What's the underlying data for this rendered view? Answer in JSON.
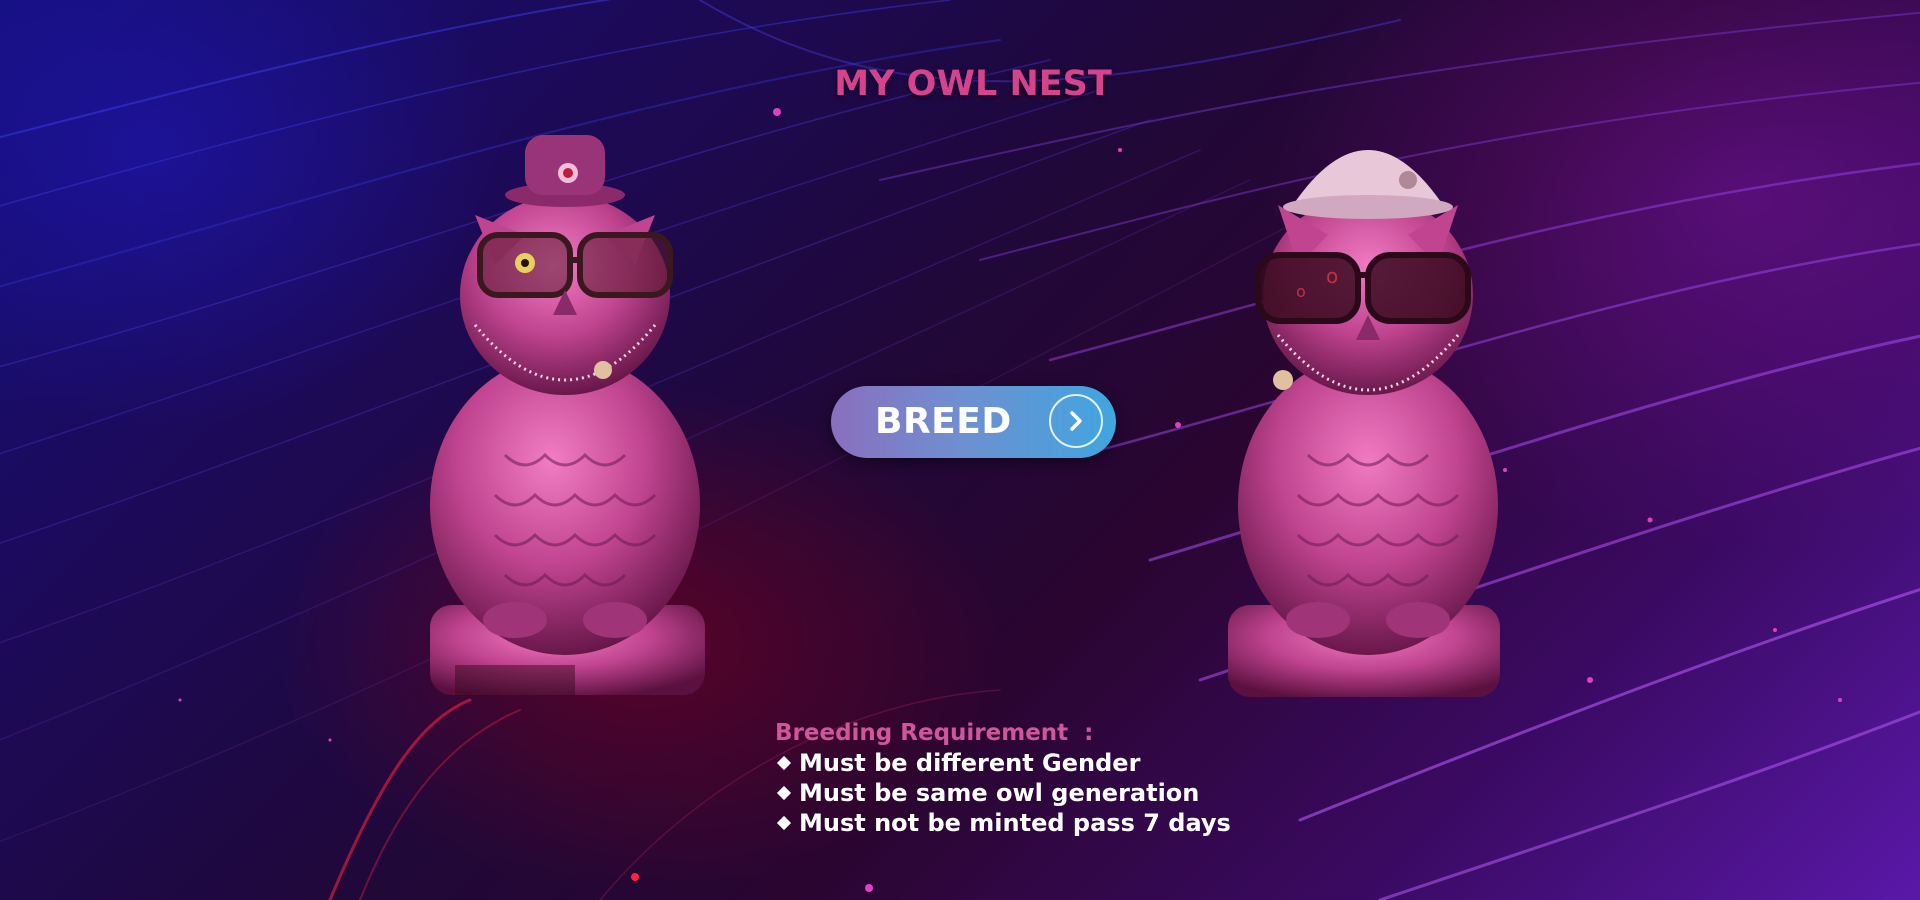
{
  "page": {
    "title": "MY OWL NEST"
  },
  "breed": {
    "button_label": "BREED",
    "icon": "chevron-right-icon"
  },
  "owls": {
    "left": {
      "image": "owl-statue-hat-glasses"
    },
    "right": {
      "image": "owl-statue-helmet-sunglasses"
    }
  },
  "requirements": {
    "heading": "Breeding Requirement  :",
    "items": [
      {
        "text": "Must be different Gender"
      },
      {
        "text": "Must be same owl generation"
      },
      {
        "text": "Must not be minted pass 7 days"
      }
    ]
  },
  "colors": {
    "title": "#d4438c",
    "heading": "#d0559a",
    "owl_pink": "#c0448f",
    "button_start": "#8a6fbe",
    "button_end": "#3fa6e0"
  }
}
